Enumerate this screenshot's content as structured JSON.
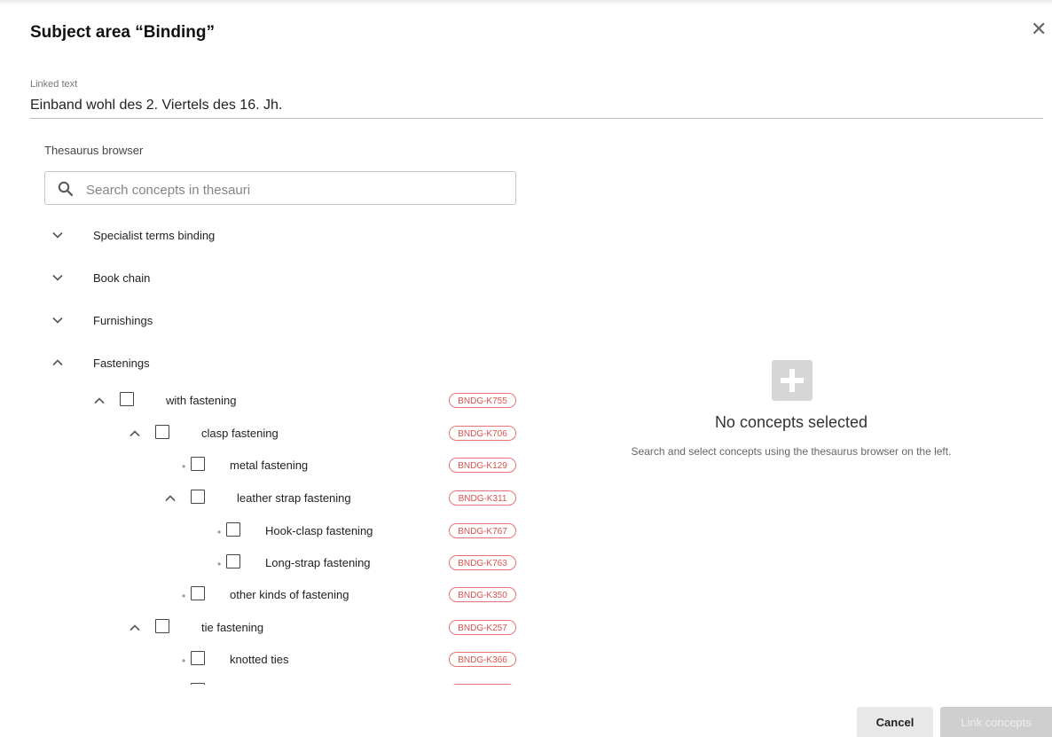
{
  "dialog": {
    "title": "Subject area “Binding”",
    "close_icon": "close-icon"
  },
  "linked_text": {
    "label": "Linked text",
    "value": "Einband wohl des 2. Viertels des 16. Jh."
  },
  "thesaurus": {
    "title": "Thesaurus browser",
    "search_placeholder": "Search concepts in thesauri",
    "search_value": "",
    "top_nodes": [
      {
        "label": "Specialist terms binding",
        "expanded": false
      },
      {
        "label": "Book chain",
        "expanded": false
      },
      {
        "label": "Furnishings",
        "expanded": false
      },
      {
        "label": "Fastenings",
        "expanded": true
      }
    ],
    "tree": [
      {
        "label": "with fastening",
        "code": "BNDG-K755",
        "depth": 0,
        "expander": "chevron-up",
        "checked": false
      },
      {
        "label": "clasp fastening",
        "code": "BNDG-K706",
        "depth": 1,
        "expander": "chevron-up",
        "checked": false
      },
      {
        "label": "metal fastening",
        "code": "BNDG-K129",
        "depth": 2,
        "expander": "bullet",
        "checked": false
      },
      {
        "label": "leather strap fastening",
        "code": "BNDG-K311",
        "depth": 2,
        "expander": "chevron-up",
        "checked": false
      },
      {
        "label": "Hook-clasp fastening",
        "code": "BNDG-K767",
        "depth": 3,
        "expander": "bullet",
        "checked": false
      },
      {
        "label": "Long-strap fastening",
        "code": "BNDG-K763",
        "depth": 3,
        "expander": "bullet",
        "checked": false
      },
      {
        "label": "other kinds of fastening",
        "code": "BNDG-K350",
        "depth": 2,
        "expander": "bullet",
        "checked": false
      },
      {
        "label": "tie fastening",
        "code": "BNDG-K257",
        "depth": 1,
        "expander": "chevron-up",
        "checked": false
      },
      {
        "label": "knotted ties",
        "code": "BNDG-K366",
        "depth": 2,
        "expander": "bullet",
        "checked": false
      },
      {
        "label": "",
        "code": "",
        "depth": 2,
        "expander": "bullet",
        "checked": false
      }
    ]
  },
  "selection": {
    "icon": "plus-icon",
    "title": "No concepts selected",
    "text": "Search and select concepts using the thesaurus browser on the left."
  },
  "footer": {
    "cancel_label": "Cancel",
    "link_label": "Link concepts"
  },
  "colors": {
    "tag": "#d9534f",
    "disabled_button": "#cfcfcf"
  }
}
